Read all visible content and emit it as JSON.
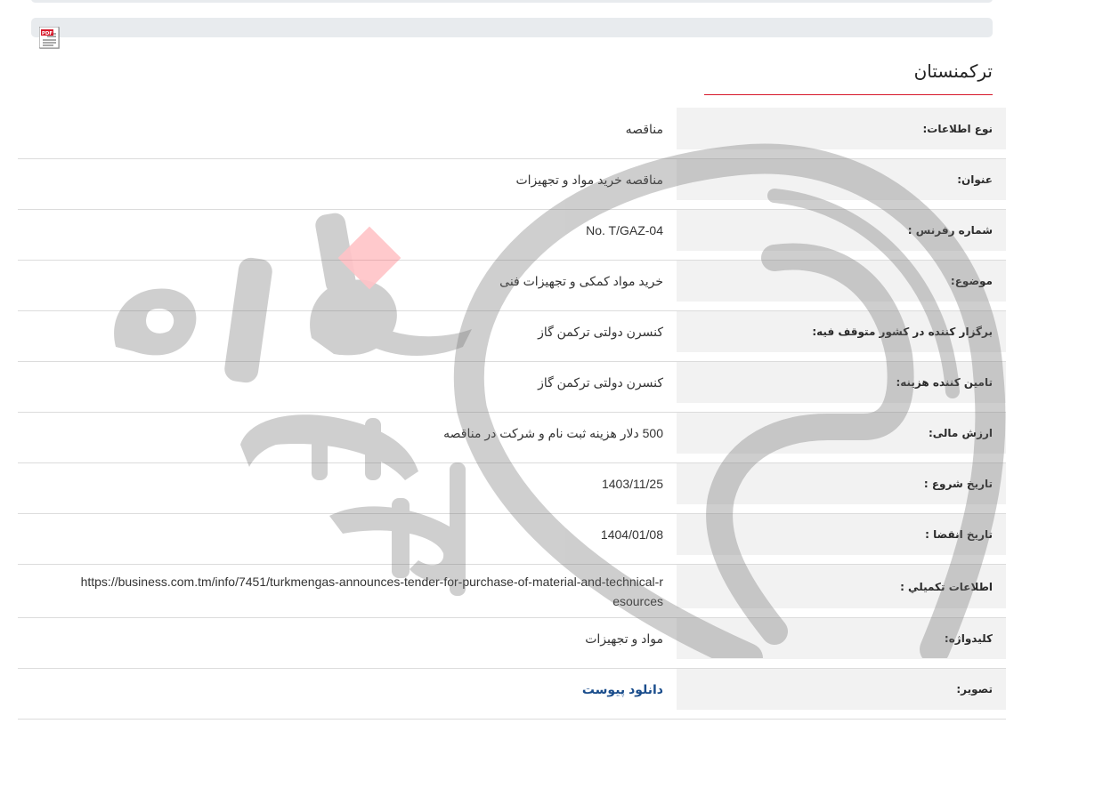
{
  "header": {
    "pdf_icon": "pdf-file-icon",
    "country": "ترکمنستان"
  },
  "colors": {
    "accent": "#d7182a",
    "link": "#1a4d8c",
    "label_bg": "#f2f2f2",
    "bar_bg": "#e8ebee"
  },
  "fields": [
    {
      "label": "نوع اطلاعات:",
      "value": "مناقصه"
    },
    {
      "label": "عنوان:",
      "value": "مناقصه خرید مواد و تجهیزات"
    },
    {
      "label": "شماره رفرنس :",
      "value": "No. T/GAZ-04"
    },
    {
      "label": "موضوع:",
      "value": "خرید مواد کمکی و تجهیزات فنی"
    },
    {
      "label": "برگزار کننده در کشور متوقف فیه:",
      "value": "کنسرن دولتی ترکمن گاز"
    },
    {
      "label": "تامین کننده هزینه:",
      "value": "کنسرن دولتی ترکمن گاز"
    },
    {
      "label": "ارزش مالی:",
      "value": "500 دلار هزینه ثبت نام و شرکت در مناقصه"
    },
    {
      "label": "تاریخ شروع :",
      "value": "1403/11/25"
    },
    {
      "label": "تاریخ انقضا :",
      "value": "1404/01/08"
    },
    {
      "label": "اطلاعات تکميلي :",
      "value": "https://business.com.tm/info/7451/turkmengas-announces-tender-for-purchase-of-material-and-technical-resources"
    },
    {
      "label": "کلیدواژه:",
      "value": "مواد و تجهیزات"
    },
    {
      "label": "تصویر:",
      "value": "دانلود پیوست"
    }
  ]
}
